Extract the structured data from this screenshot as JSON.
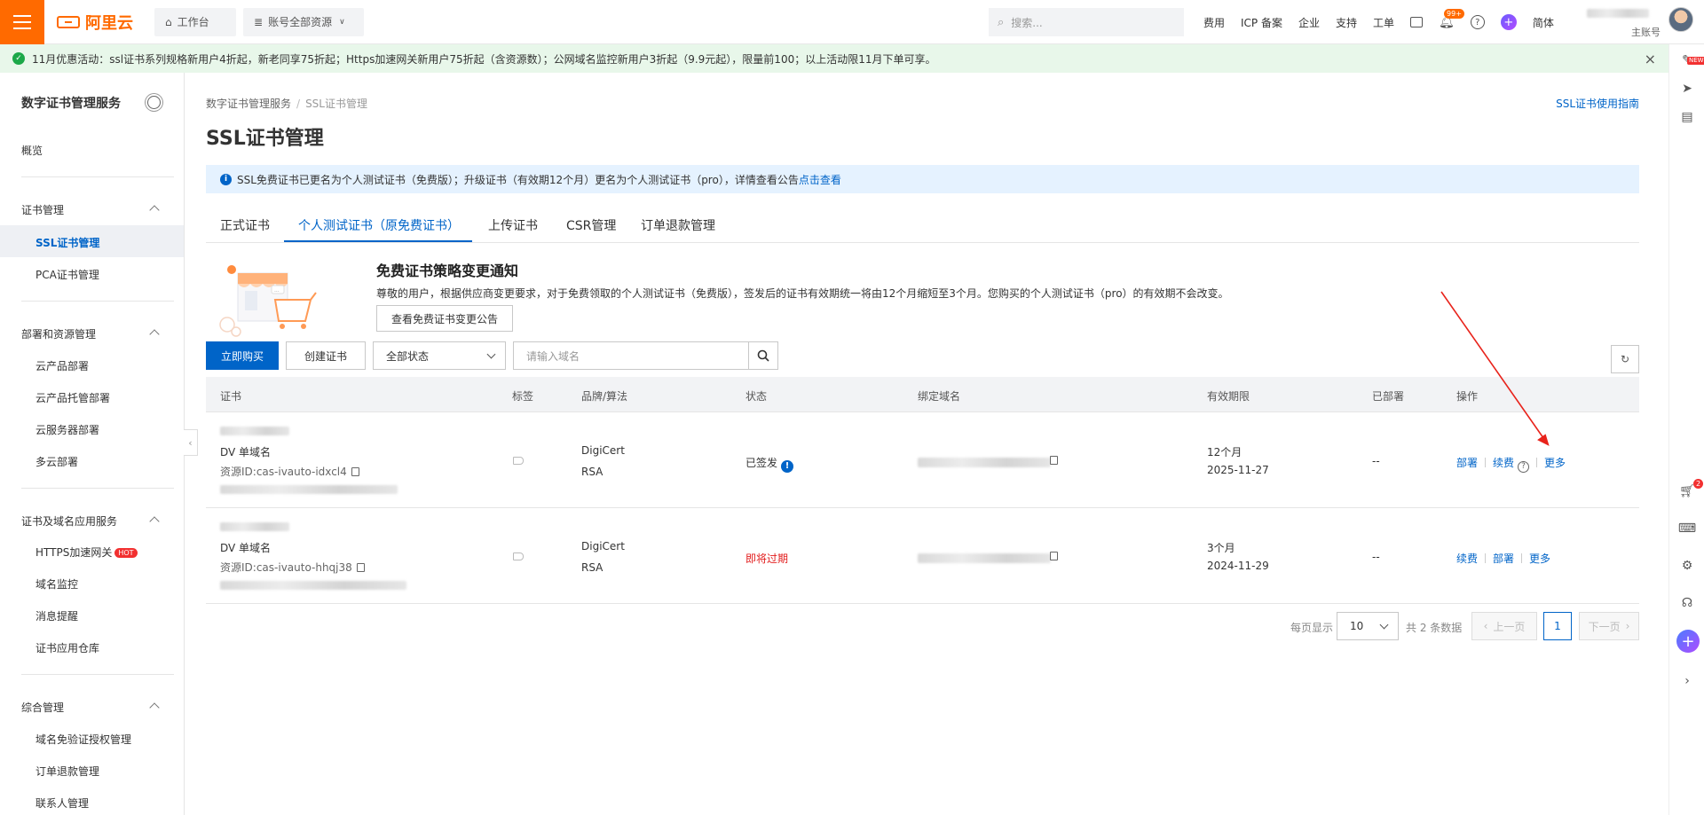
{
  "topbar": {
    "logo_text": "阿里云",
    "workbench": "工作台",
    "resource_scope": "账号全部资源",
    "search_placeholder": "搜索...",
    "nav": [
      "费用",
      "ICP 备案",
      "企业",
      "支持",
      "工单"
    ],
    "notification_count": "99+",
    "language": "简体",
    "account_role": "主账号"
  },
  "banner": {
    "text": "11月优惠活动：ssl证书系列规格新用户4折起，新老同享75折起；Https加速网关新用户75折起（含资源数）；公网域名监控新用户3折起（9.9元起），限量前100；以上活动限11月下单可享。"
  },
  "sidebar": {
    "title": "数字证书管理服务",
    "overview": "概览",
    "groups": [
      {
        "label": "证书管理",
        "items": [
          "SSL证书管理",
          "PCA证书管理"
        ]
      },
      {
        "label": "部署和资源管理",
        "items": [
          "云产品部署",
          "云产品托管部署",
          "云服务器部署",
          "多云部署"
        ]
      },
      {
        "label": "证书及域名应用服务",
        "items": [
          "HTTPS加速网关",
          "域名监控",
          "消息提醒",
          "证书应用仓库"
        ]
      },
      {
        "label": "综合管理",
        "items": [
          "域名免验证授权管理",
          "订单退款管理",
          "联系人管理"
        ]
      }
    ],
    "hot_label": "HOT"
  },
  "breadcrumb": {
    "root": "数字证书管理服务",
    "separator": "/",
    "current": "SSL证书管理"
  },
  "guide_link": "SSL证书使用指南",
  "page_title": "SSL证书管理",
  "info": {
    "text": "SSL免费证书已更名为个人测试证书（免费版）；升级证书（有效期12个月）更名为个人测试证书（pro），详情查看公告",
    "link": "点击查看"
  },
  "tabs": [
    "正式证书",
    "个人测试证书（原免费证书）",
    "上传证书",
    "CSR管理",
    "订单退款管理"
  ],
  "notice": {
    "title": "免费证书策略变更通知",
    "text": "尊敬的用户，根据供应商变更要求，对于免费领取的个人测试证书（免费版），签发后的证书有效期统一将由12个月缩短至3个月。您购买的个人测试证书（pro）的有效期不会改变。",
    "button": "查看免费证书变更公告"
  },
  "toolbar": {
    "buy": "立即购买",
    "create": "创建证书",
    "status_select": "全部状态",
    "domain_placeholder": "请输入域名"
  },
  "table": {
    "headers": [
      "证书",
      "标签",
      "品牌/算法",
      "状态",
      "绑定域名",
      "有效期限",
      "已部署",
      "操作"
    ],
    "rows": [
      {
        "type": "DV 单域名",
        "resource_id": "资源ID:cas-ivauto-idxcl4",
        "brand": "DigiCert",
        "algo": "RSA",
        "status": "已签发",
        "status_icon": "!",
        "period": "12个月",
        "expire": "2025-11-27",
        "deployed": "--",
        "actions": [
          "部署",
          "续费",
          "更多"
        ]
      },
      {
        "type": "DV 单域名",
        "resource_id": "资源ID:cas-ivauto-hhqj38",
        "brand": "DigiCert",
        "algo": "RSA",
        "status": "即将过期",
        "period": "3个月",
        "expire": "2024-11-29",
        "deployed": "--",
        "actions": [
          "续费",
          "部署",
          "更多"
        ]
      }
    ]
  },
  "pagination": {
    "per_page_label": "每页显示",
    "per_page": "10",
    "total": "共 2 条数据",
    "prev": "上一页",
    "current": "1",
    "next": "下一页"
  },
  "right_rail": {
    "new_badge": "NEW",
    "cart_count": "2"
  },
  "colors": {
    "brand": "#ff6a00",
    "primary": "#0064c8",
    "danger": "#e21d1d",
    "success": "#1ca849"
  }
}
